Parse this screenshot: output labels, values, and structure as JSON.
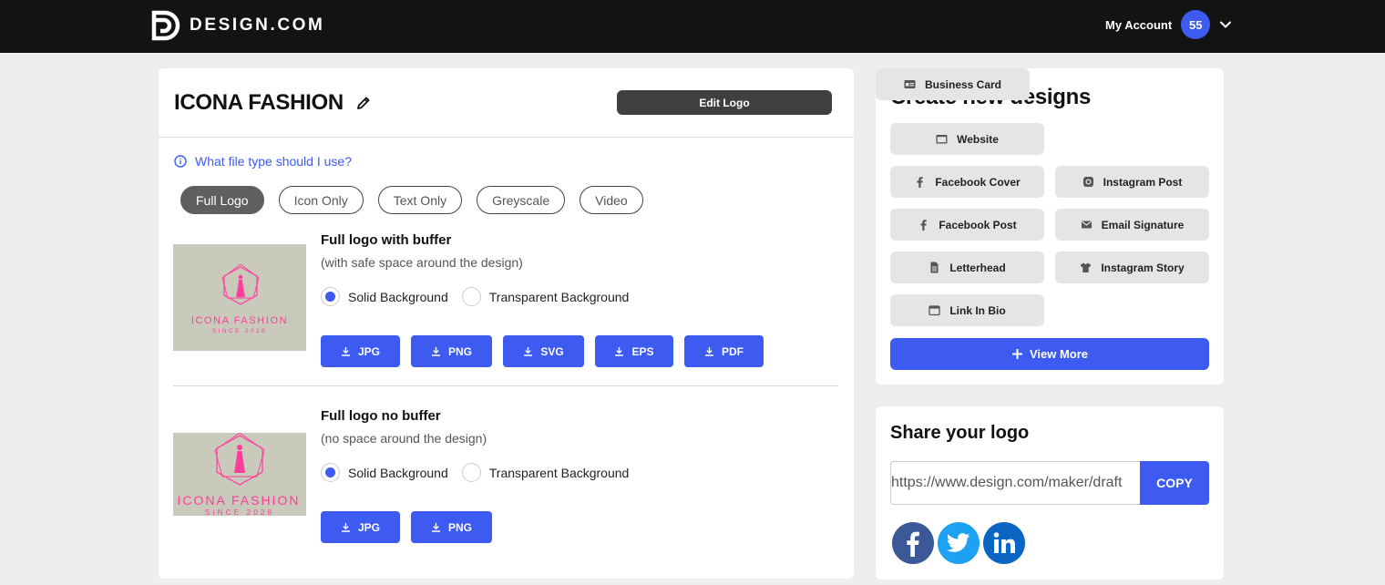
{
  "header": {
    "brand_name": "DESIGN.COM",
    "account_label": "My Account",
    "avatar_text": "55"
  },
  "logo_panel": {
    "title": "ICONA FASHION",
    "edit_logo_label": "Edit Logo",
    "help_link": "What file type should I use?",
    "filters": [
      "Full Logo",
      "Icon Only",
      "Text Only",
      "Greyscale",
      "Video"
    ],
    "active_filter": "Full Logo",
    "thumbnail": {
      "brand_text": "ICONA FASHION",
      "tagline": "SINCE 2028",
      "background_color": "#c9c9bc",
      "accent_color": "#ff3d9a"
    },
    "variants": [
      {
        "title": "Full logo with buffer",
        "subtitle": "(with safe space around the design)",
        "radio_solid": "Solid Background",
        "radio_transparent": "Transparent Background",
        "selected": "Solid Background",
        "downloads": [
          "JPG",
          "PNG",
          "SVG",
          "EPS",
          "PDF"
        ]
      },
      {
        "title": "Full logo no buffer",
        "subtitle": "(no space around the design)",
        "radio_solid": "Solid Background",
        "radio_transparent": "Transparent Background",
        "selected": "Solid Background",
        "downloads": [
          "JPG",
          "PNG"
        ]
      }
    ]
  },
  "create_panel": {
    "title": "Create new designs",
    "items": [
      {
        "label": "Website",
        "icon": "browser-window-icon"
      },
      {
        "label": "Business Card",
        "icon": "id-card-icon"
      },
      {
        "label": "Facebook Cover",
        "icon": "facebook-f-icon"
      },
      {
        "label": "Instagram Post",
        "icon": "instagram-icon"
      },
      {
        "label": "Facebook Post",
        "icon": "facebook-f-icon"
      },
      {
        "label": "Email Signature",
        "icon": "envelope-icon"
      },
      {
        "label": "Letterhead",
        "icon": "document-icon"
      },
      {
        "label": "Instagram Story",
        "icon": "tshirt-icon"
      },
      {
        "label": "Link In Bio",
        "icon": "window-icon"
      }
    ],
    "view_more_label": "View More"
  },
  "share_panel": {
    "title": "Share your logo",
    "url": "https://www.design.com/maker/draft",
    "copy_label": "COPY",
    "social": [
      {
        "name": "facebook",
        "color": "#3b5998"
      },
      {
        "name": "twitter",
        "color": "#1da1f2"
      },
      {
        "name": "linkedin",
        "color": "#0a66c2"
      }
    ]
  },
  "colors": {
    "accent": "#3d5af1",
    "topbar": "#131313",
    "page_bg": "#eeeeee"
  }
}
